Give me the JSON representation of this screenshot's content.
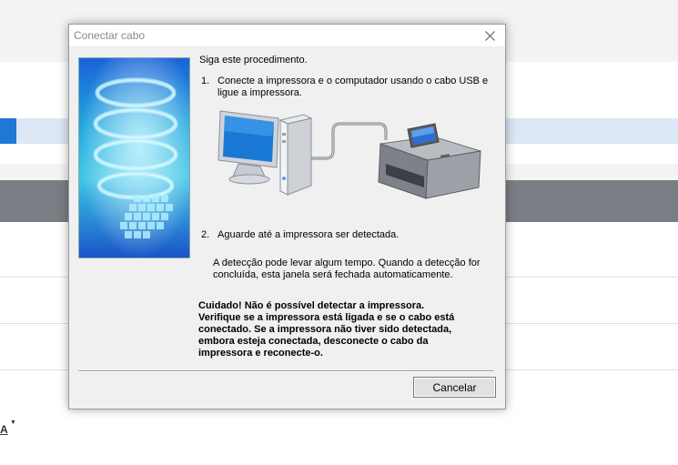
{
  "dialog": {
    "title": "Conectar cabo",
    "intro": "Siga este procedimento.",
    "step1_number": "1.",
    "step1_line1": "Conecte a impressora e o computador usando o cabo USB e",
    "step1_line2": "ligue a impressora.",
    "step2_number": "2.",
    "step2_text": "Aguarde até a impressora ser detectada.",
    "note_line1": "A detecção pode levar algum tempo. Quando a detecção for",
    "note_line2": "concluída, esta janela será fechada automaticamente.",
    "warning_lines": [
      "Cuidado! Não é possível detectar a impressora.",
      "Verifique se a impressora está ligada e se o cabo está",
      "conectado. Se a impressora não tiver sido detectada,",
      "embora esteja conectada, desconecte o cabo da",
      "impressora e reconecte-o."
    ],
    "cancel_label": "Cancelar"
  },
  "background": {
    "partial_label": "A"
  }
}
